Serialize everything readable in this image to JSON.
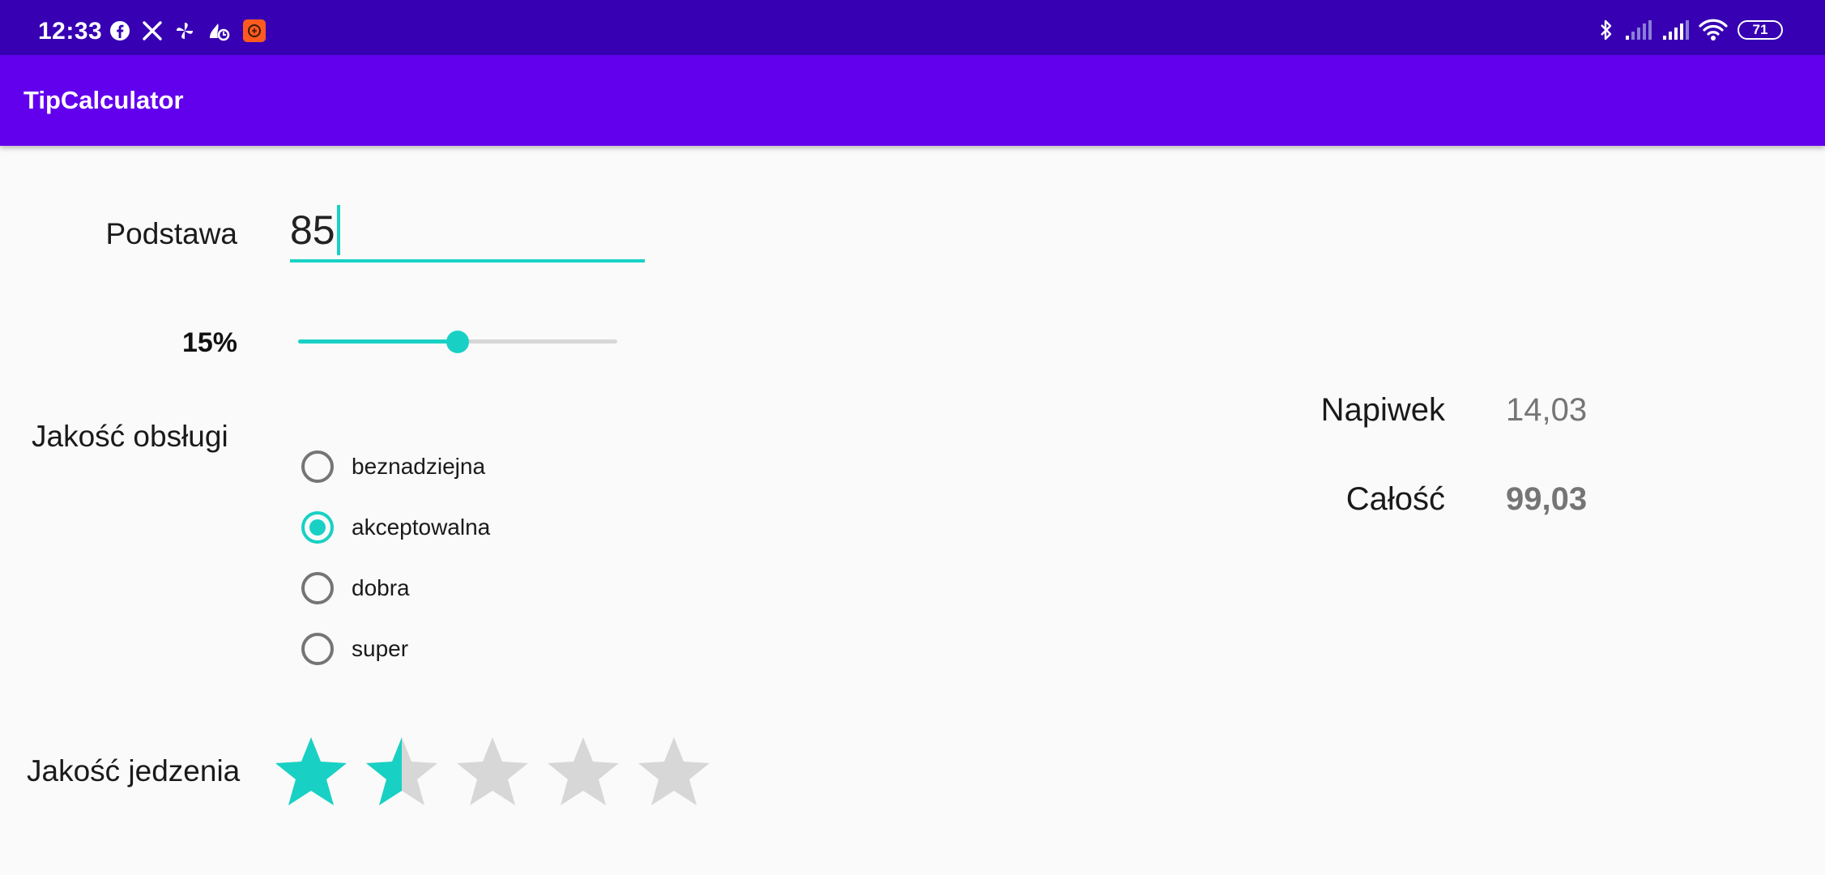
{
  "status_bar": {
    "time": "12:33",
    "left_icons": [
      "facebook-icon",
      "x-icon",
      "pinwheel-icon",
      "app-icon",
      "app-badge-icon"
    ],
    "right_icons": [
      "bluetooth-icon",
      "signal-icon",
      "signal-icon",
      "wifi-icon",
      "battery-icon"
    ],
    "battery": "71"
  },
  "app_bar": {
    "title": "TipCalculator"
  },
  "form": {
    "base_label": "Podstawa",
    "base_value": "85",
    "percent_label": "15%",
    "tip_slider_value_fraction": 0.5,
    "service_label": "Jakość obsługi",
    "service_options": [
      {
        "label": "beznadziejna",
        "checked": false
      },
      {
        "label": "akceptowalna",
        "checked": true
      },
      {
        "label": "dobra",
        "checked": false
      },
      {
        "label": "super",
        "checked": false
      }
    ],
    "food_label": "Jakość jedzenia",
    "food_rating": 1.5,
    "food_rating_max": 5
  },
  "results": {
    "tip_label": "Napiwek",
    "tip_value": "14,03",
    "total_label": "Całość",
    "total_value": "99,03"
  },
  "colors": {
    "status_bar": "#3700b3",
    "app_bar": "#6200ee",
    "accent": "#18d1c4",
    "inactive": "#d7d7d7",
    "background": "#fafafa"
  }
}
